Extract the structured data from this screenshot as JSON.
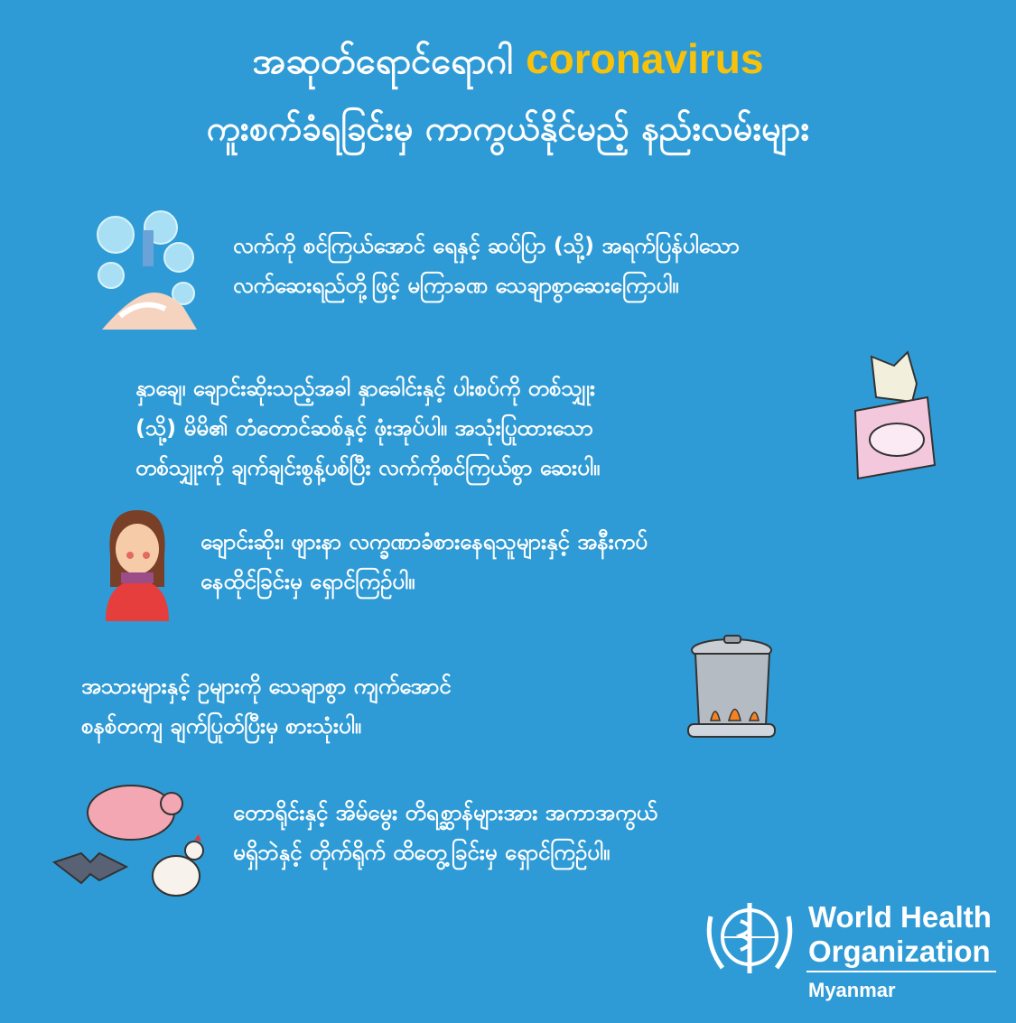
{
  "title": {
    "line1_prefix": "အဆုတ်ရောင်ရောဂါ",
    "line1_highlight": "coronavirus",
    "line2": "ကူးစက်ခံရခြင်းမှ ကာကွယ်နိုင်မည့် နည်းလမ်းများ"
  },
  "tips": [
    {
      "lines": [
        "လက်ကို စင်ကြယ်အောင် ရေနှင့် ဆပ်ပြာ (သို့) အရက်ပြန်ပါသော",
        "လက်ဆေးရည်တို့ဖြင့် မကြာခဏ သေချာစွာဆေးကြောပါ။"
      ],
      "icon": "handwashing-icon"
    },
    {
      "lines": [
        "နှာချေ၊ ချောင်းဆိုးသည့်အခါ နှာခေါင်းနှင့် ပါးစပ်ကို တစ်သျှုး",
        "(သို့) မိမိ၏ တံတောင်ဆစ်နှင့် ဖုံးအုပ်ပါ။ အသုံးပြုထားသော",
        "တစ်သျှုးကို ချက်ချင်းစွန့်ပစ်ပြီး လက်ကိုစင်ကြယ်စွာ ဆေးပါ။"
      ],
      "icon": "tissue-box-icon"
    },
    {
      "lines": [
        "ချောင်းဆိုး၊ ဖျားနာ လက္ခဏာခံစားနေရသူများနှင့် အနီးကပ်",
        "နေထိုင်ခြင်းမှ ရှောင်ကြဉ်ပါ။"
      ],
      "icon": "sick-person-icon"
    },
    {
      "lines": [
        "အသားများနှင့် ဥများကို သေချာစွာ ကျက်အောင်",
        "စနစ်တကျ ချက်ပြုတ်ပြီးမှ စားသုံးပါ။"
      ],
      "icon": "cooking-pot-icon"
    },
    {
      "lines": [
        "တောရိုင်းနှင့် အိမ်မွေး တိရစ္ဆာန်များအား အကာအကွယ်",
        "မရှိဘဲနှင့် တိုက်ရိုက် ထိတွေ့ခြင်းမှ ရှောင်ကြဉ်ပါ။"
      ],
      "icon": "animals-icon"
    }
  ],
  "organization": {
    "name_line1": "World Health",
    "name_line2": "Organization",
    "country": "Myanmar"
  },
  "colors": {
    "background": "#2f9bd6",
    "highlight": "#f9c20a",
    "text": "#ffffff"
  }
}
